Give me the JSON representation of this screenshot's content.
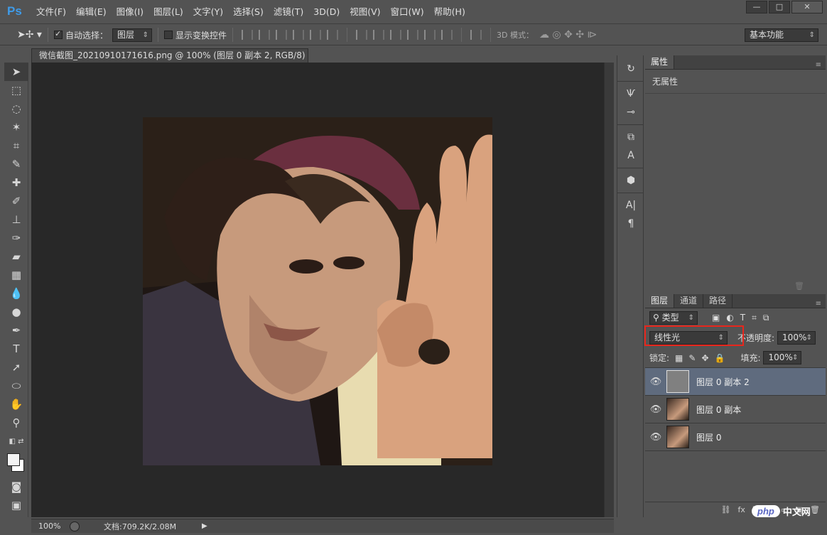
{
  "app": {
    "logo": "Ps"
  },
  "menu": [
    "文件(F)",
    "编辑(E)",
    "图像(I)",
    "图层(L)",
    "文字(Y)",
    "选择(S)",
    "滤镜(T)",
    "3D(D)",
    "视图(V)",
    "窗口(W)",
    "帮助(H)"
  ],
  "window_buttons": {
    "minimize": "—",
    "maximize": "□",
    "close": "✕"
  },
  "options": {
    "auto_select_label": "自动选择：",
    "auto_select_value": "图层",
    "show_transform_label": "显示变换控件",
    "mode_3d_label": "3D 模式：",
    "workspace_value": "基本功能"
  },
  "document": {
    "tab_title": "微信截图_20210910171616.png @ 100% (图层 0 副本 2, RGB/8) *",
    "tab_close": "×"
  },
  "status": {
    "zoom": "100%",
    "doc_info": "文档:709.2K/2.08M",
    "arrow": "▶"
  },
  "properties": {
    "tab": "属性",
    "content": "无属性"
  },
  "layers_panel": {
    "tabs": [
      "图层",
      "通道",
      "路径"
    ],
    "filter_label": "类型",
    "blend_mode": "线性光",
    "opacity_label": "不透明度:",
    "opacity_value": "100%",
    "lock_label": "锁定:",
    "fill_label": "填充:",
    "fill_value": "100%",
    "layers": [
      {
        "name": "图层 0 副本 2",
        "selected": true
      },
      {
        "name": "图层 0 副本",
        "selected": false
      },
      {
        "name": "图层 0",
        "selected": false
      }
    ],
    "footer_icons": [
      "link-icon",
      "fx-icon",
      "mask-icon",
      "adjustment-icon",
      "group-icon",
      "new-layer-icon",
      "trash-icon"
    ]
  },
  "watermark": {
    "brand": "php",
    "suffix": "中文网"
  }
}
